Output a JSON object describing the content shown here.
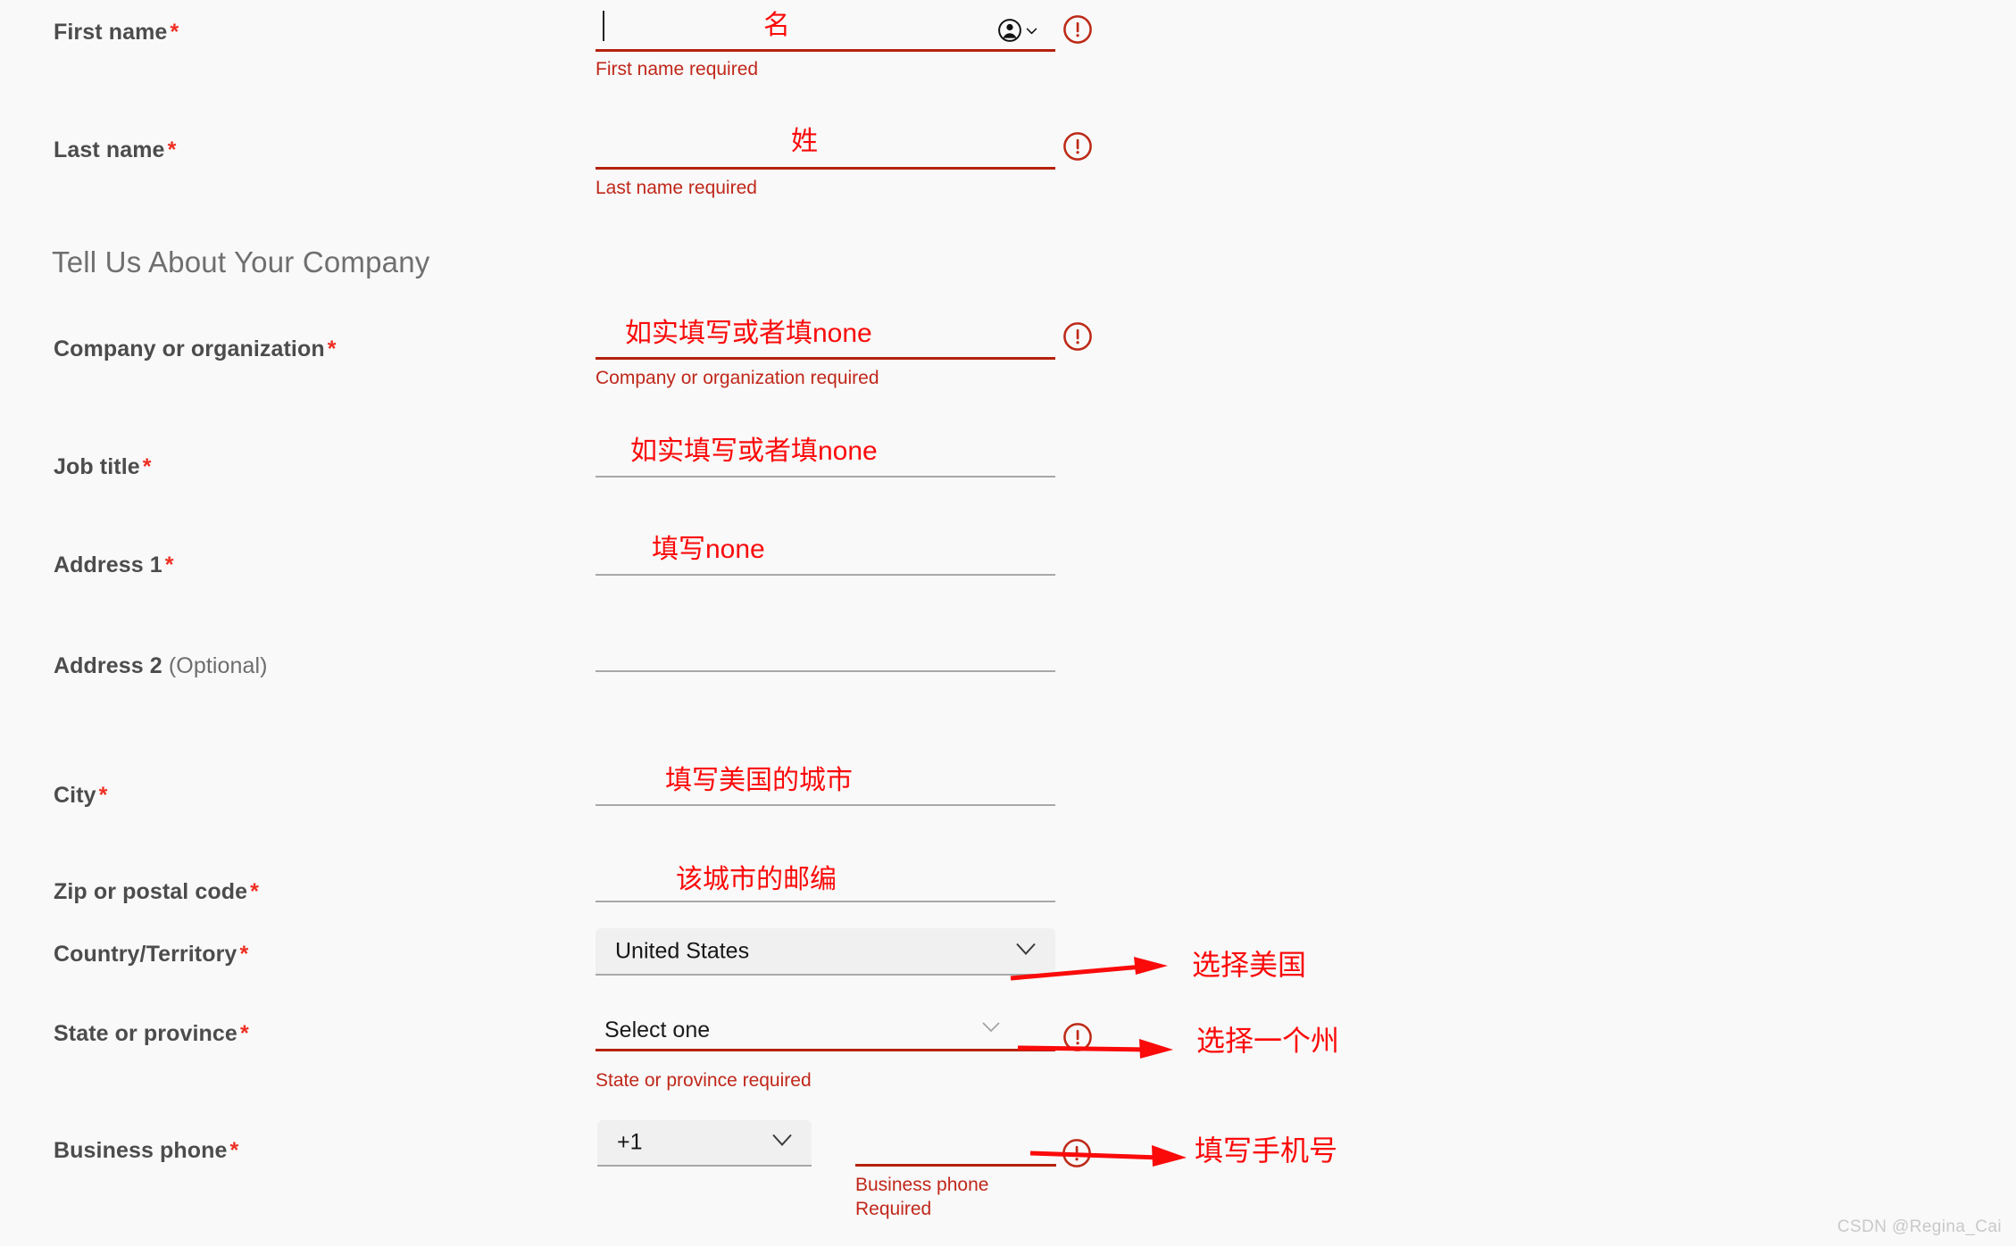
{
  "colors": {
    "label": "#4c4c4c",
    "required_star": "#ef2e22",
    "error_text": "#c0271a",
    "error_line": "#b5220d",
    "annotation_red": "#fb0a0a",
    "select_fill": "#f0f0f0",
    "page_bg": "#f9f9f9",
    "underline": "#a8a8a8",
    "watermark": "#c9c9c9"
  },
  "section_heading": "Tell Us About Your Company",
  "fields": {
    "first_name": {
      "label": "First name",
      "required_marker": "*",
      "value": "",
      "annotation": "名",
      "error": "First name required",
      "has_error": true,
      "autofill_icon": "person-circle-icon",
      "chevron_icon": "chevron-down-icon",
      "error_icon": "error-exclamation-icon",
      "caret_visible": true
    },
    "last_name": {
      "label": "Last name",
      "required_marker": "*",
      "value": "",
      "annotation": "姓",
      "error": "Last name required",
      "has_error": true,
      "error_icon": "error-exclamation-icon"
    },
    "company": {
      "label": "Company or organization",
      "required_marker": "*",
      "value": "",
      "annotation": "如实填写或者填none",
      "error": "Company or organization required",
      "has_error": true,
      "error_icon": "error-exclamation-icon"
    },
    "job_title": {
      "label": "Job title",
      "required_marker": "*",
      "value": "",
      "annotation": "如实填写或者填none",
      "error": "",
      "has_error": false
    },
    "address1": {
      "label": "Address 1",
      "required_marker": "*",
      "value": "",
      "annotation": "填写none",
      "error": "",
      "has_error": false
    },
    "address2": {
      "label": "Address 2",
      "optional_marker": "(Optional)",
      "value": "",
      "annotation": "",
      "error": "",
      "has_error": false
    },
    "city": {
      "label": "City",
      "required_marker": "*",
      "value": "",
      "annotation": "填写美国的城市",
      "error": "",
      "has_error": false
    },
    "zip": {
      "label": "Zip or postal code",
      "required_marker": "*",
      "value": "",
      "annotation": "该城市的邮编",
      "error": "",
      "has_error": false
    },
    "country": {
      "label": "Country/Territory",
      "required_marker": "*",
      "value": "United States",
      "chevron_icon": "chevron-down-icon",
      "error": "",
      "has_error": false
    },
    "state": {
      "label": "State or province",
      "required_marker": "*",
      "value": "Select one",
      "chevron_icon": "chevron-down-icon",
      "error": "State or province required",
      "has_error": true,
      "error_icon": "error-exclamation-icon"
    },
    "business_phone": {
      "label": "Business phone",
      "required_marker": "*",
      "country_code": "+1",
      "chevron_icon": "chevron-down-icon",
      "value": "",
      "error_line1": "Business phone",
      "error_line2": "Required",
      "has_error": true,
      "error_icon": "error-exclamation-icon"
    }
  },
  "annotations": [
    {
      "id": "country",
      "text": "选择美国",
      "arrow_icon": "right-arrow-icon"
    },
    {
      "id": "state",
      "text": "选择一个州",
      "arrow_icon": "right-arrow-icon"
    },
    {
      "id": "phone",
      "text": "填写手机号",
      "arrow_icon": "right-arrow-icon"
    }
  ],
  "watermark": "CSDN @Regina_Cai"
}
